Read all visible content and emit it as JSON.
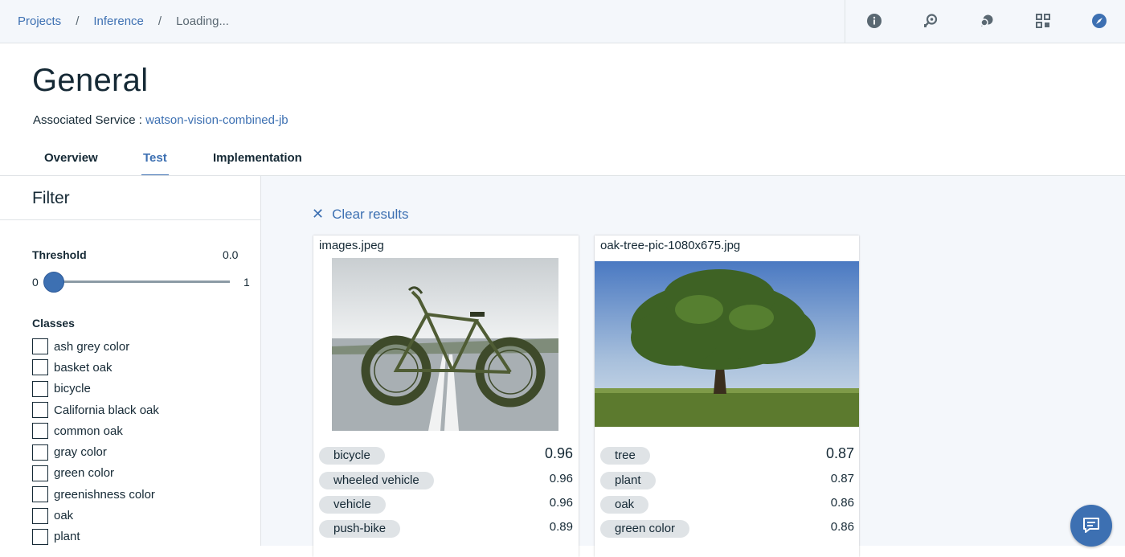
{
  "breadcrumb": {
    "items": [
      "Projects",
      "Inference"
    ],
    "separator": "/",
    "current": "Loading..."
  },
  "toolbar": {
    "icons": [
      "info-icon",
      "search-docs-icon",
      "chat-bubbles-icon",
      "apps-grid-icon",
      "compass-icon"
    ]
  },
  "page": {
    "title": "General",
    "associated_label": "Associated Service :",
    "associated_value": "watson-vision-combined-jb"
  },
  "tabs": [
    {
      "label": "Overview",
      "active": false
    },
    {
      "label": "Test",
      "active": true
    },
    {
      "label": "Implementation",
      "active": false
    }
  ],
  "filter": {
    "title": "Filter",
    "threshold_label": "Threshold",
    "threshold_value": "0.0",
    "slider_min": "0",
    "slider_max": "1",
    "slider_level": 0.0,
    "classes_label": "Classes",
    "classes": [
      "ash grey color",
      "basket oak",
      "bicycle",
      "California black oak",
      "common oak",
      "gray color",
      "green color",
      "greenishness color",
      "oak",
      "plant"
    ]
  },
  "results": {
    "clear_label": "Clear results",
    "cards": [
      {
        "filename": "images.jpeg",
        "image": "bicycle-photo",
        "tags": [
          {
            "label": "bicycle",
            "score": "0.96"
          },
          {
            "label": "wheeled vehicle",
            "score": "0.96"
          },
          {
            "label": "vehicle",
            "score": "0.96"
          },
          {
            "label": "push-bike",
            "score": "0.89"
          }
        ]
      },
      {
        "filename": "oak-tree-pic-1080x675.jpg",
        "image": "oak-tree-photo",
        "tags": [
          {
            "label": "tree",
            "score": "0.87"
          },
          {
            "label": "plant",
            "score": "0.87"
          },
          {
            "label": "oak",
            "score": "0.86"
          },
          {
            "label": "green color",
            "score": "0.86"
          }
        ]
      }
    ]
  },
  "colors": {
    "accent": "#3d70b2",
    "tag_bg": "#dfe3e6",
    "main_bg": "#f4f7fb"
  }
}
